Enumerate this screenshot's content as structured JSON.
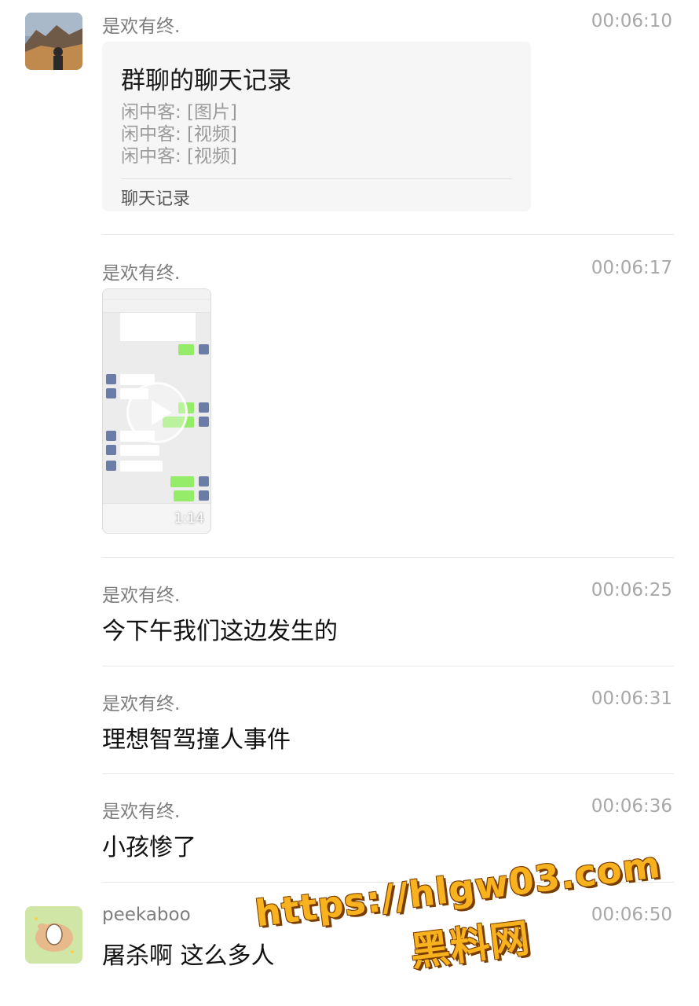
{
  "messages": [
    {
      "sender": "是欢有终.",
      "time": "00:06:10",
      "chat_record": {
        "title": "群聊的聊天记录",
        "lines": [
          "闲中客: [图片]",
          "闲中客: [视频]",
          "闲中客: [视频]"
        ],
        "footer": "聊天记录"
      }
    },
    {
      "sender": "是欢有终.",
      "time": "00:06:17",
      "video": {
        "duration": "1:14"
      }
    },
    {
      "sender": "是欢有终.",
      "time": "00:06:25",
      "text": "今下午我们这边发生的"
    },
    {
      "sender": "是欢有终.",
      "time": "00:06:31",
      "text": "理想智驾撞人事件"
    },
    {
      "sender": "是欢有终.",
      "time": "00:06:36",
      "text": "小孩惨了"
    },
    {
      "sender": "peekaboo",
      "time": "00:06:50",
      "text": "屠杀啊 这么多人"
    }
  ],
  "watermark": {
    "url": "https://hlgw03.com",
    "name": "黑料网"
  }
}
